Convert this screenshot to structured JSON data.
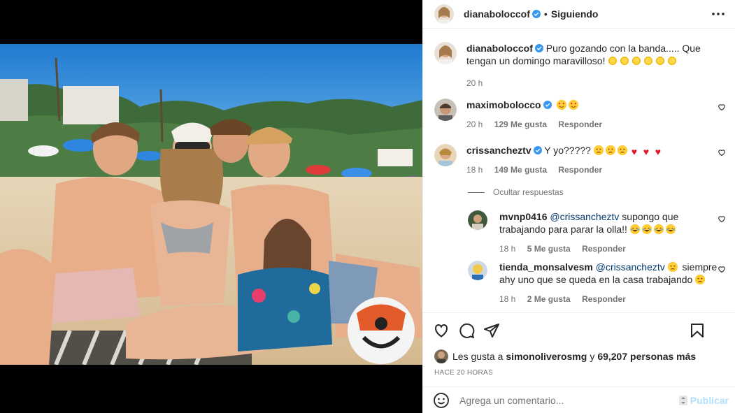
{
  "post": {
    "author": "dianaboloccof",
    "follow_status": "Siguiendo",
    "separator": "•",
    "caption": "Puro gozando con la banda..... Que tengan un domingo maravilloso!",
    "caption_time": "20 h"
  },
  "comments": [
    {
      "user": "maximobolocco",
      "verified": true,
      "text": "",
      "emojis": [
        "heart-eyes",
        "heart-eyes"
      ],
      "time": "20 h",
      "likes": "129 Me gusta",
      "reply": "Responder"
    },
    {
      "user": "crissancheztv",
      "verified": false,
      "text": "Y yo?????",
      "emojis": [
        "sad",
        "sad",
        "sad",
        "heart",
        "heart",
        "heart"
      ],
      "time": "18 h",
      "likes": "149 Me gusta",
      "reply": "Responder"
    }
  ],
  "hide_replies": "Ocultar respuestas",
  "replies": [
    {
      "user": "mvnp0416",
      "mention": "@crissancheztv",
      "text": "supongo que trabajando para parar la olla!!",
      "emojis": [
        "laugh",
        "laugh",
        "laugh",
        "laugh"
      ],
      "time": "18 h",
      "likes": "5 Me gusta",
      "reply": "Responder"
    },
    {
      "user": "tienda_monsalvesm",
      "mention": "@crissancheztv",
      "text": "siempre ahy uno que se queda en la casa trabajando",
      "emojis": [
        "sad"
      ],
      "time": "18 h",
      "likes": "2 Me gusta",
      "reply": "Responder"
    }
  ],
  "likes": {
    "prefix": "Les gusta a",
    "user": "simonoliverosmg",
    "connector": "y",
    "others": "69,207 personas más"
  },
  "time_ago": "HACE 20 HORAS",
  "comment_box": {
    "placeholder": "Agrega un comentario...",
    "publish": "Publicar"
  },
  "icons": {
    "more": "more-icon",
    "like": "heart-icon",
    "comment": "comment-icon",
    "share": "send-icon",
    "save": "bookmark-icon",
    "emoji": "emoji-icon"
  },
  "colors": {
    "link": "#00376b",
    "muted": "#737373",
    "verified": "#3897f0",
    "publish_disabled": "#b2dffc"
  }
}
